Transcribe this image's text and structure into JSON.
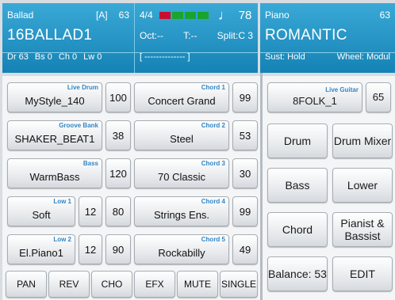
{
  "style_section": {
    "label": "Ballad",
    "mode": "[A]",
    "number": "63",
    "name": "16BALLAD1",
    "status": {
      "dr": "Dr 63",
      "bs": "Bs 0",
      "ch": "Ch 0",
      "lw": "Lw 0"
    }
  },
  "mid_section": {
    "time_sig": "4/4",
    "tempo_indicator_colors": [
      "#c8102e",
      "#1aa32e",
      "#1aa32e",
      "#1aa32e"
    ],
    "tempo": "78",
    "octave": "Oct:--",
    "transpose": "T:--",
    "split": "Split:C 3",
    "chord_display": "[ -------------- ]"
  },
  "voice_section": {
    "label": "Piano",
    "number": "63",
    "name": "ROMANTIC",
    "sustain": "Sust: Hold",
    "wheel": "Wheel: Modul"
  },
  "parts_left": [
    {
      "tag": "Live Drum",
      "name": "MyStyle_140",
      "value": "100"
    },
    {
      "tag": "Groove Bank",
      "name": "SHAKER_BEAT1",
      "value": "38"
    },
    {
      "tag": "Bass",
      "name": "WarmBass",
      "value": "120"
    },
    {
      "tag": "Low 1",
      "name": "Soft",
      "extra": "12",
      "value": "80"
    },
    {
      "tag": "Low 2",
      "name": "El.Piano1",
      "extra": "12",
      "value": "90"
    }
  ],
  "parts_chord": [
    {
      "tag": "Chord 1",
      "name": "Concert Grand",
      "value": "99"
    },
    {
      "tag": "Chord 2",
      "name": "Steel",
      "value": "53"
    },
    {
      "tag": "Chord 3",
      "name": "70 Classic",
      "value": "30"
    },
    {
      "tag": "Chord 4",
      "name": "Strings Ens.",
      "value": "99"
    },
    {
      "tag": "Chord 5",
      "name": "Rockabilly",
      "value": "49"
    }
  ],
  "bottom_bar": [
    "PAN",
    "REV",
    "CHO",
    "EFX",
    "MUTE",
    "SINGLE"
  ],
  "live_guitar": {
    "tag": "Live Guitar",
    "name": "8FOLK_1",
    "value": "65"
  },
  "right_buttons": {
    "drum": "Drum",
    "drum_mixer": "Drum Mixer",
    "bass": "Bass",
    "lower": "Lower",
    "chord": "Chord",
    "pianist_bassist": "Pianist & Bassist",
    "balance": "Balance: 53",
    "edit": "EDIT"
  }
}
